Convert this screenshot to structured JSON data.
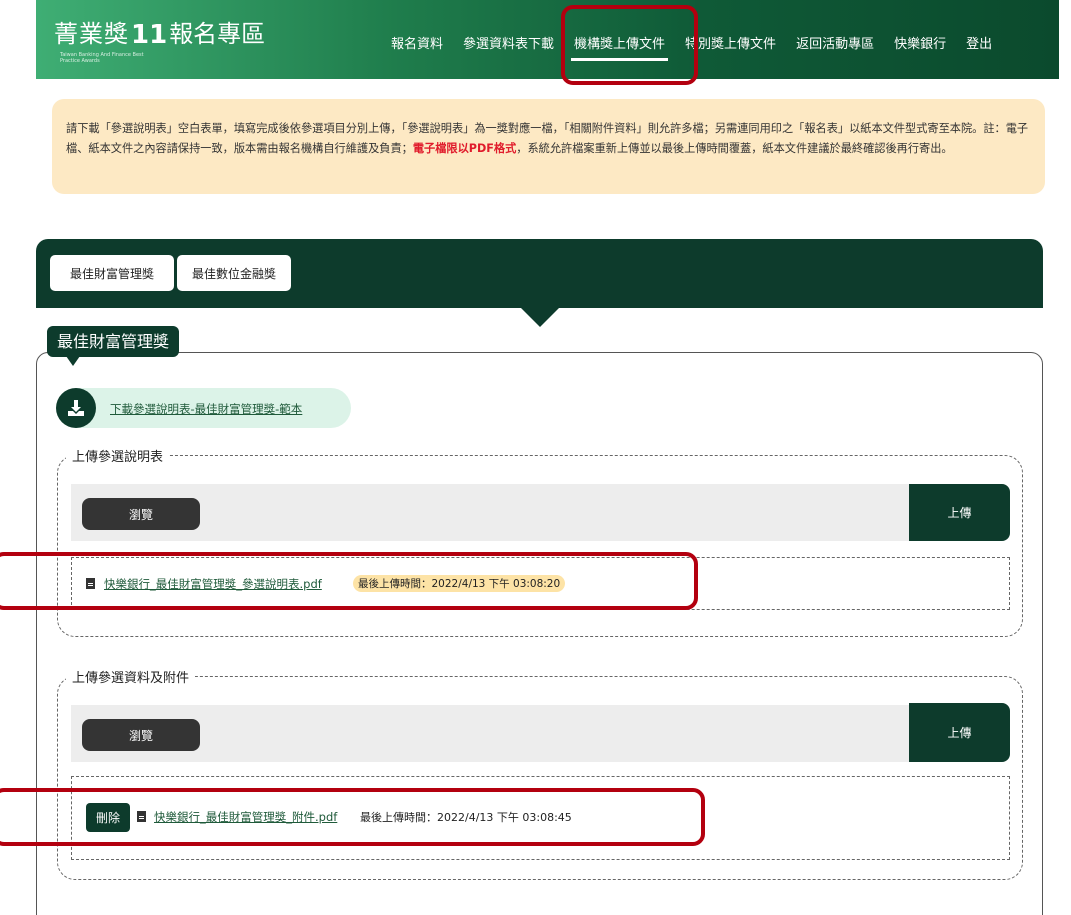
{
  "header": {
    "logo_part1": "菁業獎",
    "logo_number": "11",
    "logo_part2": "報名專區",
    "logo_subtitle": "Taiwan Banking And Finance Best Practice Awards",
    "nav": [
      {
        "label": "報名資料",
        "active": false
      },
      {
        "label": "參選資料表下載",
        "active": false
      },
      {
        "label": "機構獎上傳文件",
        "active": true
      },
      {
        "label": "特別獎上傳文件",
        "active": false
      },
      {
        "label": "返回活動專區",
        "active": false
      },
      {
        "label": "快樂銀行",
        "active": false
      },
      {
        "label": "登出",
        "active": false
      }
    ]
  },
  "notice": {
    "text_before": "請下載「參選說明表」空白表單，填寫完成後依參選項目分別上傳，「參選說明表」為一獎對應一檔，「相關附件資料」則允許多檔；另需連同用印之「報名表」以紙本文件型式寄至本院。註：電子檔、紙本文件之內容請保持一致，版本需由報名機構自行維護及負責；",
    "text_red": "電子檔限以PDF格式",
    "text_after": "，系統允許檔案重新上傳並以最後上傳時間覆蓋，紙本文件建議於最終確認後再行寄出。"
  },
  "award_tabs": [
    "最佳財富管理獎",
    "最佳數位金融獎"
  ],
  "panel": {
    "title": "最佳財富管理獎",
    "download_link": "下載參選說明表-最佳財富管理獎-範本",
    "section1": {
      "legend": "上傳參選說明表",
      "browse_label": "瀏覽",
      "upload_label": "上傳",
      "file_name": "快樂銀行_最佳財富管理獎_參選說明表.pdf",
      "time_label": "最後上傳時間：",
      "time_value": "2022/4/13 下午 03:08:20"
    },
    "section2": {
      "legend": "上傳參選資料及附件",
      "browse_label": "瀏覽",
      "upload_label": "上傳",
      "delete_label": "刪除",
      "file_name": "快樂銀行_最佳財富管理獎_附件.pdf",
      "time_label": "最後上傳時間：",
      "time_value": "2022/4/13 下午 03:08:45"
    }
  },
  "colors": {
    "dark_green": "#0d3b2c",
    "highlight_red": "#b3000f",
    "notice_bg": "#fde9c4",
    "notice_red": "#e01b2b"
  }
}
